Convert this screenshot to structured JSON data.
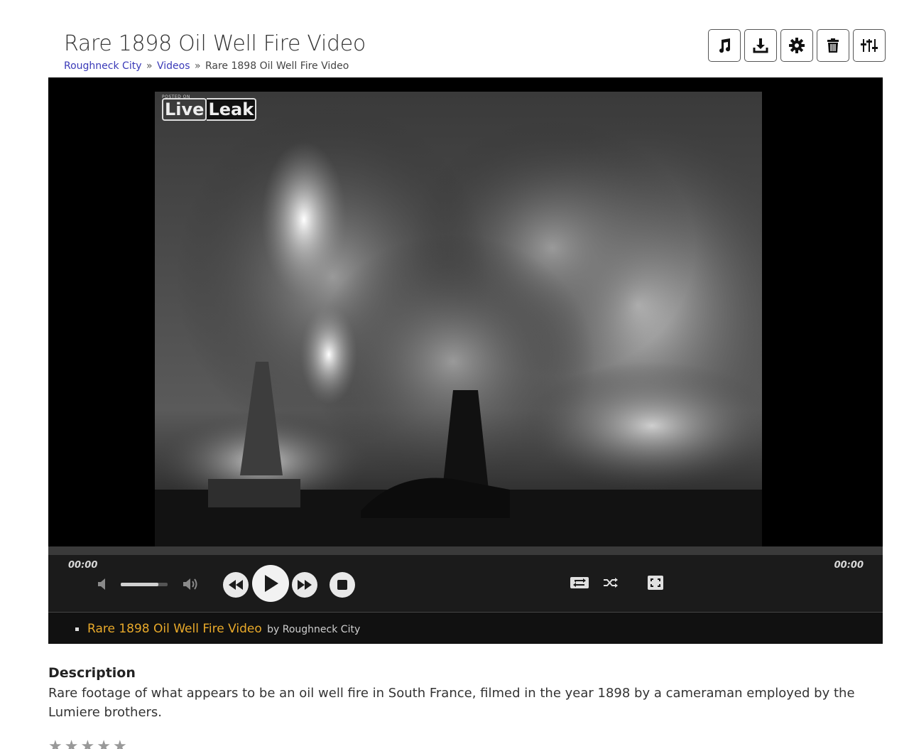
{
  "page": {
    "title": "Rare 1898 Oil Well Fire Video"
  },
  "breadcrumb": {
    "home": "Roughneck City",
    "separator": "»",
    "section": "Videos",
    "current": "Rare 1898 Oil Well Fire Video"
  },
  "toolbar": {
    "buttons": [
      {
        "icon": "music-note-icon"
      },
      {
        "icon": "download-icon"
      },
      {
        "icon": "gear-icon"
      },
      {
        "icon": "trash-icon"
      },
      {
        "icon": "sliders-icon"
      }
    ]
  },
  "player": {
    "watermark_posted": "POSTED ON",
    "watermark_live": "Live",
    "watermark_leak": "Leak",
    "time_current": "00:00",
    "time_duration": "00:00",
    "volume_level": 0.8,
    "progress": 0
  },
  "playlist": {
    "item_title": "Rare 1898 Oil Well Fire Video",
    "item_by": "by Roughneck City"
  },
  "description": {
    "heading": "Description",
    "text": "Rare footage of what appears to be an oil well fire in South France, filmed in the year 1898 by a cameraman employed by the Lumiere brothers."
  },
  "rating": {
    "stars": 5,
    "star_glyph": "★"
  },
  "colors": {
    "link": "#3a3ab8",
    "playlist_title": "#e8a92a",
    "player_bg": "#000000",
    "controls_bg": "#1b1b1b"
  }
}
